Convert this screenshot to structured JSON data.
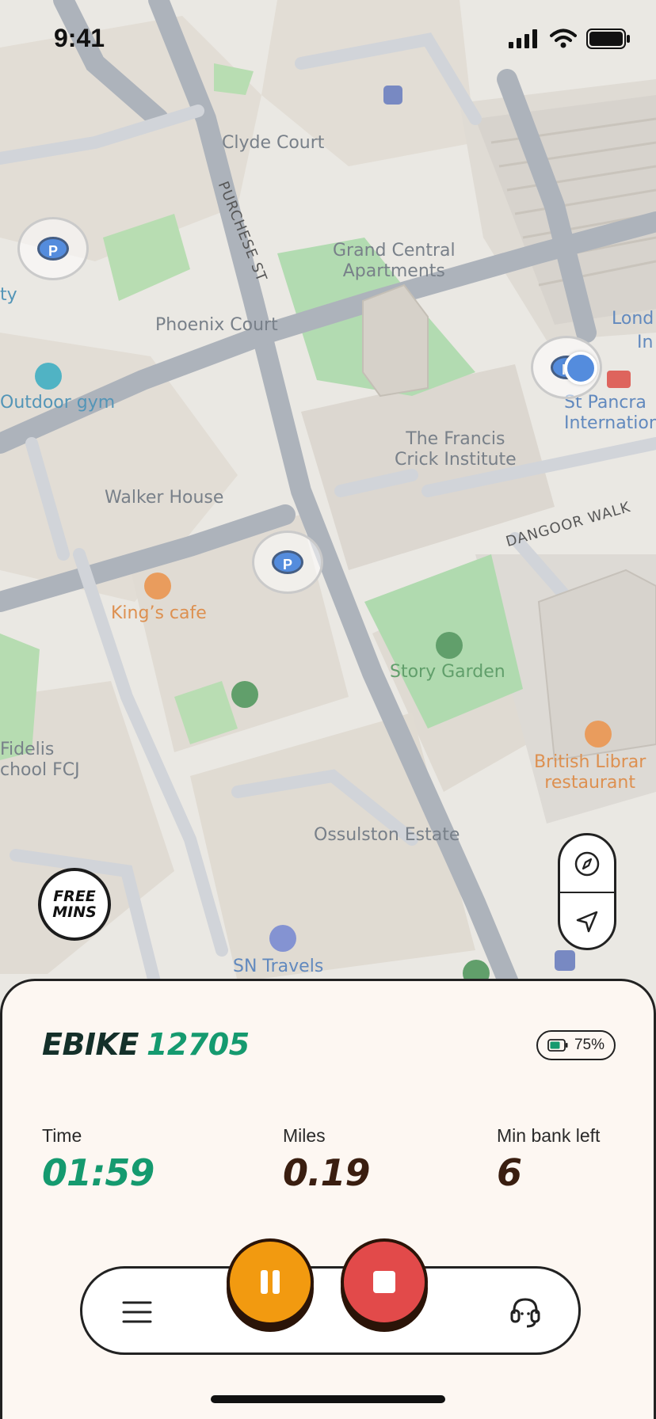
{
  "status_bar": {
    "time": "9:41"
  },
  "map": {
    "labels": {
      "clyde_court": "Clyde Court",
      "purchese_st": "PURCHESE ST",
      "grand_central": "Grand Central\nApartments",
      "phoenix_court": "Phoenix Court",
      "outdoor_gym": "Outdoor gym",
      "ty": "ty",
      "london": "Lond",
      "london_in": "In",
      "st_pancras": "St Pancra\nInternation",
      "francis_crick": "The Francis\nCrick Institute",
      "dangoor_walk": "DANGOOR WALK",
      "walker_house": "Walker House",
      "kings_cafe": "King’s cafe",
      "story_garden": "Story Garden",
      "british_library": "British Librar\nrestaurant",
      "fidelis": "Fidelis\nchool FCJ",
      "ossulston": "Ossulston Estate",
      "sn_travels": "SN Travels"
    },
    "parking_symbol": "P",
    "free_mins_badge": "FREE\nMINS"
  },
  "ride": {
    "bike_type": "EBIKE",
    "bike_number": "12705",
    "battery_percent": "75%",
    "battery_level": 0.75,
    "stats": {
      "time_label": "Time",
      "time_value": "01:59",
      "miles_label": "Miles",
      "miles_value": "0.19",
      "min_bank_label": "Min bank left",
      "min_bank_value": "6"
    }
  },
  "colors": {
    "accent_green": "#159a6f",
    "dark_brown": "#3a1e10",
    "pause_orange": "#f29a10",
    "stop_red": "#e24a4a",
    "sheet_bg": "#fdf7f2"
  },
  "icons": {
    "menu": "menu-icon",
    "pause": "pause-icon",
    "stop": "stop-icon",
    "support": "headset-icon",
    "compass": "compass-icon",
    "locate": "location-arrow-icon"
  }
}
